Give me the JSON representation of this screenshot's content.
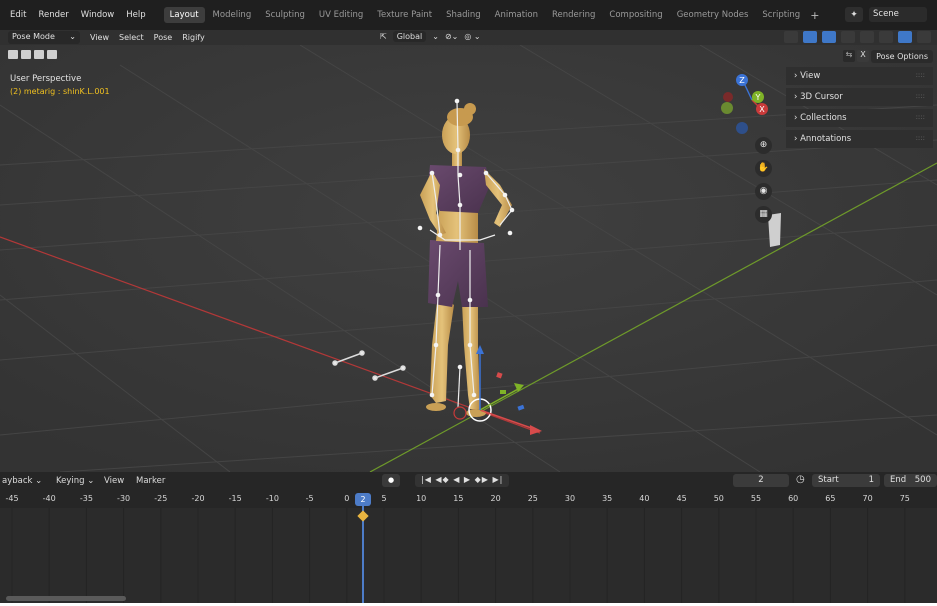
{
  "topbar": {
    "menus": [
      "Edit",
      "Render",
      "Window",
      "Help"
    ],
    "workspaces": [
      "Layout",
      "Modeling",
      "Sculpting",
      "UV Editing",
      "Texture Paint",
      "Shading",
      "Animation",
      "Rendering",
      "Compositing",
      "Geometry Nodes",
      "Scripting"
    ],
    "active_workspace": "Layout",
    "add_workspace": "+",
    "scene_name": "Scene"
  },
  "viewport_header": {
    "mode": "Pose Mode",
    "menus": [
      "View",
      "Select",
      "Pose",
      "Rigify"
    ],
    "transform_orientation": "Global",
    "pose_options_label": "Pose Options",
    "close_label": "X"
  },
  "viewport": {
    "perspective_label": "User Perspective",
    "active_object_label": "(2) metarig : shinK.L.001",
    "gizmo_axes": [
      "Z",
      "Y",
      "X"
    ]
  },
  "sidebar_panel": {
    "items": [
      "View",
      "3D Cursor",
      "Collections",
      "Annotations"
    ]
  },
  "timeline": {
    "menus": [
      "ayback",
      "Keying",
      "View",
      "Marker"
    ],
    "playback_controls": "|◀ ◀◆ ◀ ▶ ◆▶ ▶|",
    "current_frame": "2",
    "start_label": "Start",
    "start_value": "1",
    "end_label": "End",
    "end_value": "500",
    "ruler_ticks": [
      "-45",
      "-40",
      "-35",
      "-30",
      "-25",
      "-20",
      "-15",
      "-10",
      "-5",
      "0",
      "5",
      "10",
      "15",
      "20",
      "25",
      "30",
      "35",
      "40",
      "45",
      "50",
      "55",
      "60",
      "65",
      "70",
      "75"
    ],
    "playhead_frame": "2"
  },
  "colors": {
    "accent": "#4d7cc8",
    "x_axis": "#c93a3a",
    "y_axis": "#7fb327",
    "z_axis": "#3b73d6",
    "active_label": "#f0c020"
  }
}
